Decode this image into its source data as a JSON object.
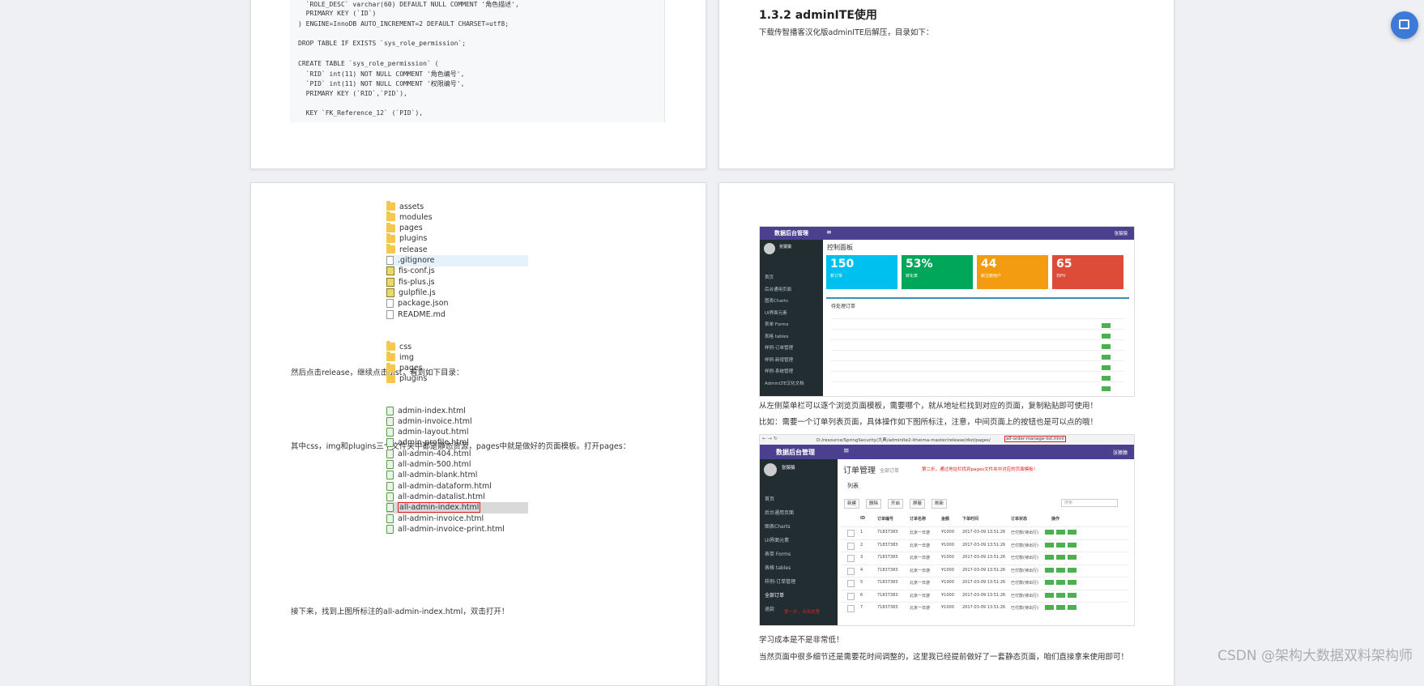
{
  "code": [
    {
      "t": "  `ROLE_DESC` varchar(60) DEFAULT NULL COMMENT '角色描述',"
    },
    {
      "t": "  PRIMARY KEY (`ID`)"
    },
    {
      "t": ") ENGINE=InnoDB AUTO_INCREMENT=2 DEFAULT CHARSET=utf8;"
    },
    {
      "t": ""
    },
    {
      "t": "DROP TABLE IF EXISTS `sys_role_permission`;"
    },
    {
      "t": ""
    },
    {
      "t": "CREATE TABLE `sys_role_permission` ("
    },
    {
      "t": "  `RID` int(11) NOT NULL COMMENT '角色编号',"
    },
    {
      "t": "  `PID` int(11) NOT NULL COMMENT '权限编号',"
    },
    {
      "t": "  PRIMARY KEY (`RID`,`PID`),"
    },
    {
      "t": ""
    },
    {
      "t": "  KEY `FK_Reference_12` (`PID`),"
    }
  ],
  "section_title": "1.3.2 adminITE使用",
  "section_intro": "下载传智播客汉化版adminITE后解压，目录如下：",
  "tree1": [
    "assets",
    "modules",
    "pages",
    "plugins",
    "release",
    ".gitignore",
    "fis-conf.js",
    "fis-plus.js",
    "gulpfile.js",
    "package.json",
    "README.md"
  ],
  "text_release": "然后点击release，继续点击dist，看到如下目录：",
  "tree2": [
    "css",
    "img",
    "pages",
    "plugins"
  ],
  "text_static": "其中css，img和plugins三个文件夹中都是静态资源，pages中就是做好的页面模板。打开pages：",
  "tree3": [
    "admin-index.html",
    "admin-invoice.html",
    "admin-layout.html",
    "admin-profile.html",
    "all-admin-404.html",
    "all-admin-500.html",
    "all-admin-blank.html",
    "all-admin-dataform.html",
    "all-admin-datalist.html",
    "all-admin-index.html",
    "all-admin-invoice.html",
    "all-admin-invoice-print.html"
  ],
  "text_next": "接下来，找到上图所标注的all-admin-index.html，双击打开！",
  "ss1": {
    "brand": "数据后台管理",
    "user": "张猿猿",
    "dash_title": "控制面板",
    "stats": [
      {
        "n": "150",
        "l": "新订单",
        "color": "#00c0ef"
      },
      {
        "n": "53%",
        "l": "转化率",
        "color": "#00a65a"
      },
      {
        "n": "44",
        "l": "新注册用户",
        "color": "#f39c12"
      },
      {
        "n": "65",
        "l": "日PV",
        "color": "#dd4b39"
      }
    ],
    "panel_title": "待处理订单",
    "menu": [
      "首页",
      "后台通用页面",
      "图表Charts",
      "UI界面元素",
      "表单 Forms",
      "表格 tables",
      "样例-订单管理",
      "样例-新增管理",
      "样例-系统管理",
      "AdminLTE汉化文档"
    ]
  },
  "text_sidebar": "从左侧菜单栏可以逐个浏览页面模板，需要哪个，就从地址栏找到对应的页面，复制粘贴即可使用！",
  "text_example": "比如：需要一个订单列表页面，具体操作如下图所标注，注意，中间页面上的按钮也是可以点的哦！",
  "ss2": {
    "url": "D:/resource/SpringSecurity/大典/adminlte2-itheima-master/release/dist/pages/",
    "url_hl": "all-order-manage-list.html",
    "title": "订单管理",
    "subtitle": "全部订单",
    "note": "第二步，通过地址栏找到pages文件夹中对应的页面模板！",
    "list_label": "列表",
    "toolbar": [
      "新建",
      "删除",
      "开启",
      "屏蔽",
      "刷新"
    ],
    "headers": [
      "ID",
      "订单编号",
      "订单名称",
      "金额",
      "下单时间",
      "订单状态",
      "操作"
    ],
    "rows": [
      [
        "1",
        "71837383",
        "北京一日游",
        "¥1000",
        "2017-03-09 13:51:26",
        "已付款(待出行)"
      ],
      [
        "2",
        "71837383",
        "北京一日游",
        "¥1000",
        "2017-03-09 13:51:26",
        "已付款(待出行)"
      ],
      [
        "3",
        "71837383",
        "北京一日游",
        "¥1000",
        "2017-03-09 13:51:26",
        "已付款(待出行)"
      ],
      [
        "4",
        "71837383",
        "北京一日游",
        "¥1000",
        "2017-03-09 13:51:26",
        "已付款(待出行)"
      ],
      [
        "5",
        "71837383",
        "北京一日游",
        "¥1000",
        "2017-03-09 13:51:26",
        "已付款(待出行)"
      ],
      [
        "6",
        "71837383",
        "北京一日游",
        "¥1000",
        "2017-03-09 13:51:26",
        "已付款(待出行)"
      ],
      [
        "7",
        "71837383",
        "北京一日游",
        "¥1000",
        "2017-03-09 13:51:26",
        "已付款(待出行)"
      ]
    ],
    "menu": [
      "首页",
      "后台通用页面",
      "图表Charts",
      "UI界面元素",
      "表单 Forms",
      "表格 tables",
      "样例-订单管理",
      "全部订单",
      "退款"
    ],
    "step1": "第一步，点击这里",
    "search_placeholder": "搜索"
  },
  "text_cost": "学习成本是不是非常低！",
  "text_ready": "当然页面中很多细节还是需要花时间调整的，这里我已经提前做好了一套静态页面，咱们直接拿来使用即可！",
  "watermark": "CSDN @架构大数据双料架构师"
}
